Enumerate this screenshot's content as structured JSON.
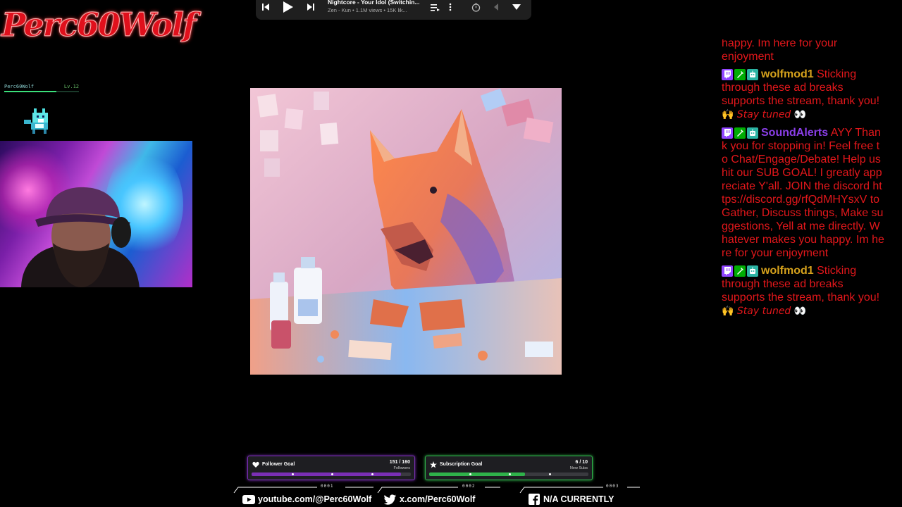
{
  "logo": {
    "text": "Perc60Wolf"
  },
  "mini_overlay": {
    "name": "Perc60Wolf",
    "level": "Lv.12",
    "fill": 0.7
  },
  "player": {
    "track_title": "Nightcore - Your Idol (Switchin...",
    "track_subtitle": "Zen - Kun • 1.1M views • 15K lik...",
    "icons": [
      "previous-icon",
      "play-icon",
      "next-icon",
      "queue-icon",
      "more-icon",
      "timer-icon",
      "collapse-icon",
      "dropdown-icon"
    ]
  },
  "chat": {
    "top_fragment_1": "happy. Im here for your",
    "top_fragment_2": "enjoyment",
    "messages": [
      {
        "user": "wolfmod1",
        "user_color": "#d6a21c",
        "text": "Sticking through these ad breaks supports the stream, thank you!",
        "emote_text": "Stay tuned"
      },
      {
        "user": "SoundAlerts",
        "user_color": "#8a3ee8",
        "text": "AYY Thank you for stopping in! Feel free to Chat/Engage/Debate! Help us hit our SUB GOAL! I greatly appreciate Y'all. JOIN the discord https://discord.gg/rfQdMHYsxV to Gather, Discuss things, Make suggestions, Yell at me directly. Whatever makes you happy. Im here for your enjoyment"
      },
      {
        "user": "wolfmod1",
        "user_color": "#d6a21c",
        "text": "Sticking through these ad breaks supports the stream, thank you!",
        "emote_text": "Stay tuned"
      }
    ],
    "text_color": "#e3171b"
  },
  "goals": {
    "follower": {
      "label": "Follower Goal",
      "count": "151 / 160",
      "unit": "Followers",
      "progress": 0.94,
      "color": "#7a2fb5"
    },
    "subscription": {
      "label": "Subscription Goal",
      "count": "6 / 10",
      "unit": "New Subs",
      "progress": 0.6,
      "color": "#2fb24a"
    }
  },
  "socials": {
    "youtube": "youtube.com/@Perc60Wolf",
    "x": "x.com/Perc60Wolf",
    "facebook": "N/A CURRENTLY",
    "tag_1": "0001",
    "tag_2": "0002",
    "tag_3": "0003"
  }
}
